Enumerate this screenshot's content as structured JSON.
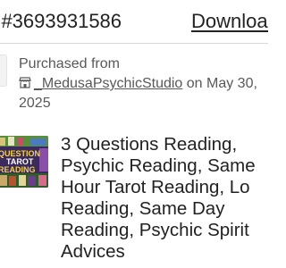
{
  "order": {
    "number_text": "r #3693931586",
    "download_label": "Download"
  },
  "purchase": {
    "label": "Purchased from",
    "shop_name": "_MedusaPsychicStudio",
    "date_text": " on May 30,",
    "year_text": "2025"
  },
  "product": {
    "title": "3 Questions Reading,\nPsychic Reading, Same\nHour Tarot Reading, Lo\nReading, Same Day\nReading, Psychic Spirit\nAdvices",
    "thumbnail_text": {
      "line1": "QUESTION",
      "line2": "TAROT",
      "line3": "READING"
    }
  }
}
